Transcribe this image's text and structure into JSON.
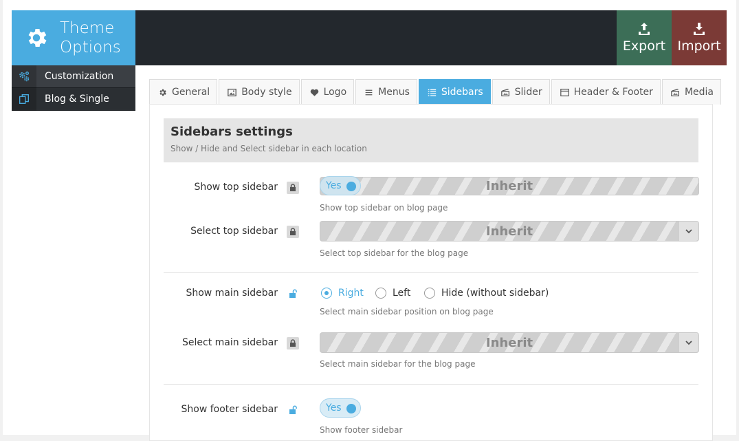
{
  "header": {
    "title_line1": "Theme",
    "title_line2": "Options",
    "export_label": "Export",
    "import_label": "Import",
    "colors": {
      "logo_bg": "#4aace0",
      "bar_bg": "#23282d",
      "export_bg": "#3c6e57",
      "import_bg": "#7b3a36"
    }
  },
  "sidebar": {
    "items": [
      {
        "label": "Customization",
        "icon": "gears-icon"
      },
      {
        "label": "Blog & Single",
        "icon": "copy-icon"
      }
    ]
  },
  "tabs": [
    {
      "label": "General",
      "icon": "gear-icon"
    },
    {
      "label": "Body style",
      "icon": "image-icon"
    },
    {
      "label": "Logo",
      "icon": "heart-icon"
    },
    {
      "label": "Menus",
      "icon": "menu-icon"
    },
    {
      "label": "Sidebars",
      "icon": "list-icon",
      "active": true
    },
    {
      "label": "Slider",
      "icon": "slider-icon"
    },
    {
      "label": "Header & Footer",
      "icon": "window-icon"
    },
    {
      "label": "Media",
      "icon": "media-icon"
    }
  ],
  "section": {
    "title": "Sidebars settings",
    "description": "Show / Hide and Select sidebar in each location"
  },
  "fields": {
    "show_top": {
      "label": "Show top sidebar",
      "toggle": "Yes",
      "value": "Inherit",
      "desc": "Show top sidebar on blog page"
    },
    "select_top": {
      "label": "Select top sidebar",
      "value": "Inherit",
      "desc": "Select top sidebar for the blog page"
    },
    "show_main": {
      "label": "Show main sidebar",
      "options": [
        "Right",
        "Left",
        "Hide (without sidebar)"
      ],
      "selected": "Right",
      "desc": "Select main sidebar position on blog page"
    },
    "select_main": {
      "label": "Select main sidebar",
      "value": "Inherit",
      "desc": "Select main sidebar for the blog page"
    },
    "show_footer": {
      "label": "Show footer sidebar",
      "toggle": "Yes",
      "desc": "Show footer sidebar"
    }
  },
  "accent": "#4aace0"
}
